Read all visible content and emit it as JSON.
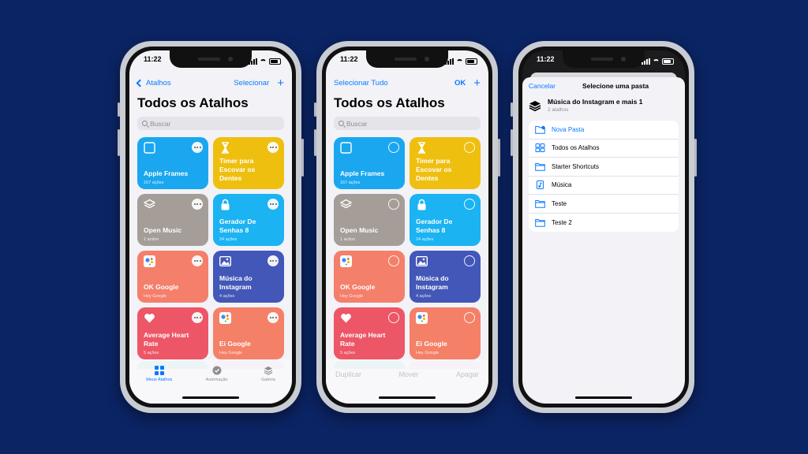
{
  "status_time": "11:22",
  "phone1": {
    "back_label": "Atalhos",
    "select_label": "Selecionar",
    "add_label": "+",
    "title": "Todos os Atalhos",
    "search_placeholder": "Buscar",
    "cards": [
      {
        "title": "Apple Frames",
        "subtitle": "167 ações",
        "color": "#1aa7f0",
        "icon": "square-icon"
      },
      {
        "title": "Timer para Escovar os Dentes",
        "subtitle": "",
        "color": "#efbf10",
        "icon": "hourglass-icon"
      },
      {
        "title": "Open Music",
        "subtitle": "1 action",
        "color": "#a59d98",
        "icon": "layers-icon"
      },
      {
        "title": "Gerador De Senhas 8",
        "subtitle": "24 ações",
        "color": "#1bb3f2",
        "icon": "lock-icon"
      },
      {
        "title": "OK Google",
        "subtitle": "Hey Google",
        "color": "#f47f6a",
        "icon": "google-assistant-icon"
      },
      {
        "title": "Música do Instagram",
        "subtitle": "4 ações",
        "color": "#4257b8",
        "icon": "photo-icon"
      },
      {
        "title": "Average Heart Rate",
        "subtitle": "5 ações",
        "color": "#ed5666",
        "icon": "heart-icon"
      },
      {
        "title": "Ei Google",
        "subtitle": "Hey Google",
        "color": "#f48068",
        "icon": "google-assistant-icon"
      }
    ],
    "tabs": [
      {
        "label": "Meus Atalhos",
        "icon": "grid-icon",
        "active": true
      },
      {
        "label": "Automação",
        "icon": "automation-icon",
        "active": false
      },
      {
        "label": "Galeria",
        "icon": "gallery-icon",
        "active": false
      }
    ]
  },
  "phone2": {
    "select_all_label": "Selecionar Tudo",
    "ok_label": "OK",
    "add_label": "+",
    "title": "Todos os Atalhos",
    "search_placeholder": "Buscar",
    "toolbar": {
      "duplicate": "Duplicar",
      "move": "Mover",
      "delete": "Apagar"
    }
  },
  "phone3": {
    "cancel_label": "Cancelar",
    "sheet_title": "Selecione uma pasta",
    "selection_name": "Música do Instagram e mais 1",
    "selection_count": "2 atalhos",
    "folders": [
      {
        "label": "Nova Pasta",
        "icon": "new-folder-icon"
      },
      {
        "label": "Todos os Atalhos",
        "icon": "grid-icon"
      },
      {
        "label": "Starter Shortcuts",
        "icon": "folder-icon"
      },
      {
        "label": "Música",
        "icon": "music-doc-icon"
      },
      {
        "label": "Teste",
        "icon": "folder-icon"
      },
      {
        "label": "Teste 2",
        "icon": "folder-icon"
      }
    ]
  },
  "colors": {
    "background": "#0b2464",
    "accent": "#0a7aff"
  }
}
